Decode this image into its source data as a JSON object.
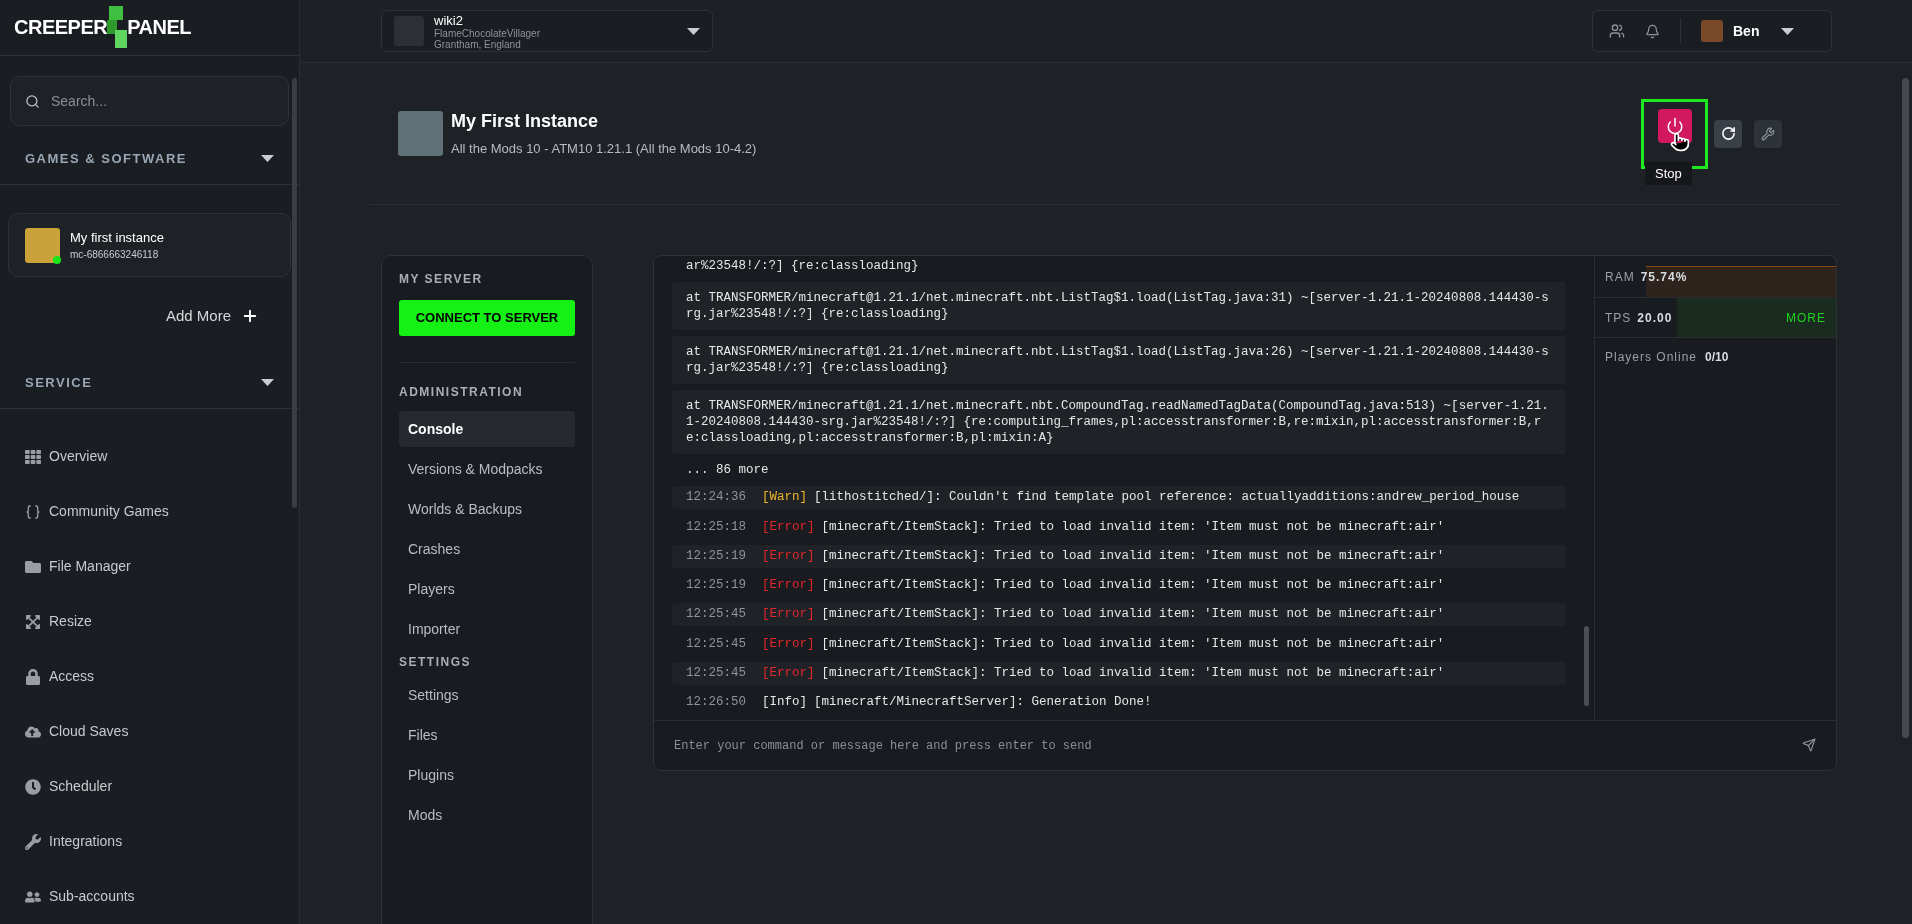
{
  "logo": {
    "left": "CREEPER",
    "right": "PANEL"
  },
  "sidebar": {
    "search": {
      "placeholder": "Search..."
    },
    "games_heading": "GAMES & SOFTWARE",
    "instance": {
      "name": "My first instance",
      "id": "mc-6866663246118",
      "online": true
    },
    "add_more": "Add More",
    "service_heading": "SERVICE",
    "items": [
      {
        "label": "Overview"
      },
      {
        "label": "Community Games"
      },
      {
        "label": "File Manager"
      },
      {
        "label": "Resize"
      },
      {
        "label": "Access"
      },
      {
        "label": "Cloud Saves"
      },
      {
        "label": "Scheduler"
      },
      {
        "label": "Integrations"
      },
      {
        "label": "Sub-accounts"
      }
    ]
  },
  "topbar": {
    "server": {
      "name": "wiki2",
      "host": "FlameChocolateVillager",
      "location": "Grantham, England"
    },
    "user": {
      "name": "Ben"
    }
  },
  "header": {
    "title": "My First Instance",
    "subtitle": "All the Mods 10 - ATM10 1.21.1 (All the Mods 10-4.2)",
    "tooltip": "Stop"
  },
  "server_menu": {
    "my_server_heading": "MY SERVER",
    "connect_button": "CONNECT TO SERVER",
    "sections": [
      {
        "title": "ADMINISTRATION",
        "items": [
          {
            "label": "Console",
            "selected": true
          },
          {
            "label": "Versions & Modpacks",
            "selected": false
          },
          {
            "label": "Worlds & Backups",
            "selected": false
          },
          {
            "label": "Crashes",
            "selected": false
          },
          {
            "label": "Players",
            "selected": false
          },
          {
            "label": "Importer",
            "selected": false
          }
        ]
      },
      {
        "title": "SETTINGS",
        "items": [
          {
            "label": "Settings",
            "selected": false
          },
          {
            "label": "Files",
            "selected": false
          },
          {
            "label": "Plugins",
            "selected": false
          },
          {
            "label": "Mods",
            "selected": false
          }
        ]
      }
    ]
  },
  "console": {
    "lines": [
      {
        "kind": "plain",
        "text": "ar%23548!/:?] {re:classloading}"
      },
      {
        "kind": "trace",
        "text": "at TRANSFORMER/minecraft@1.21.1/net.minecraft.nbt.ListTag$1.load(ListTag.java:31) ~[server-1.21.1-20240808.144430-srg.jar%23548!/:?] {re:classloading}"
      },
      {
        "kind": "trace",
        "text": "at TRANSFORMER/minecraft@1.21.1/net.minecraft.nbt.ListTag$1.load(ListTag.java:26) ~[server-1.21.1-20240808.144430-srg.jar%23548!/:?] {re:classloading}"
      },
      {
        "kind": "trace",
        "text": "at TRANSFORMER/minecraft@1.21.1/net.minecraft.nbt.CompoundTag.readNamedTagData(CompoundTag.java:513) ~[server-1.21.1-20240808.144430-srg.jar%23548!/:?] {re:computing_frames,pl:accesstransformer:B,re:mixin,pl:accesstransformer:B,re:classloading,pl:accesstransformer:B,pl:mixin:A}"
      },
      {
        "kind": "plain",
        "text": "... 86 more"
      },
      {
        "kind": "log",
        "time": "12:24:36",
        "color": "#f0b429",
        "tag": "[Warn]",
        "text": "[lithostitched/]: Couldn't find template pool reference: actuallyadditions:andrew_period_house"
      },
      {
        "kind": "log",
        "time": "12:25:18",
        "color": "#e5262b",
        "tag": "[Error]",
        "text": "[minecraft/ItemStack]: Tried to load invalid item: 'Item must not be minecraft:air'"
      },
      {
        "kind": "log",
        "time": "12:25:19",
        "color": "#e5262b",
        "tag": "[Error]",
        "text": "[minecraft/ItemStack]: Tried to load invalid item: 'Item must not be minecraft:air'"
      },
      {
        "kind": "log",
        "time": "12:25:19",
        "color": "#e5262b",
        "tag": "[Error]",
        "text": "[minecraft/ItemStack]: Tried to load invalid item: 'Item must not be minecraft:air'"
      },
      {
        "kind": "log",
        "time": "12:25:45",
        "color": "#e5262b",
        "tag": "[Error]",
        "text": "[minecraft/ItemStack]: Tried to load invalid item: 'Item must not be minecraft:air'"
      },
      {
        "kind": "log",
        "time": "12:25:45",
        "color": "#e5262b",
        "tag": "[Error]",
        "text": "[minecraft/ItemStack]: Tried to load invalid item: 'Item must not be minecraft:air'"
      },
      {
        "kind": "log",
        "time": "12:25:45",
        "color": "#e5262b",
        "tag": "[Error]",
        "text": "[minecraft/ItemStack]: Tried to load invalid item: 'Item must not be minecraft:air'"
      },
      {
        "kind": "log",
        "time": "12:26:50",
        "color": "#e8e8e8",
        "tag": "[Info]",
        "text": "[minecraft/MinecraftServer]: Generation Done!"
      }
    ],
    "input": {
      "placeholder": "Enter your command or message here and press enter to send"
    }
  },
  "stats": {
    "ram": {
      "label": "RAM",
      "value": "75.74%",
      "level": 0.79
    },
    "tps": {
      "label": "TPS",
      "value": "20.00",
      "level": 0.66,
      "more": "MORE"
    },
    "players": {
      "label": "Players Online",
      "value": "0/10"
    }
  }
}
